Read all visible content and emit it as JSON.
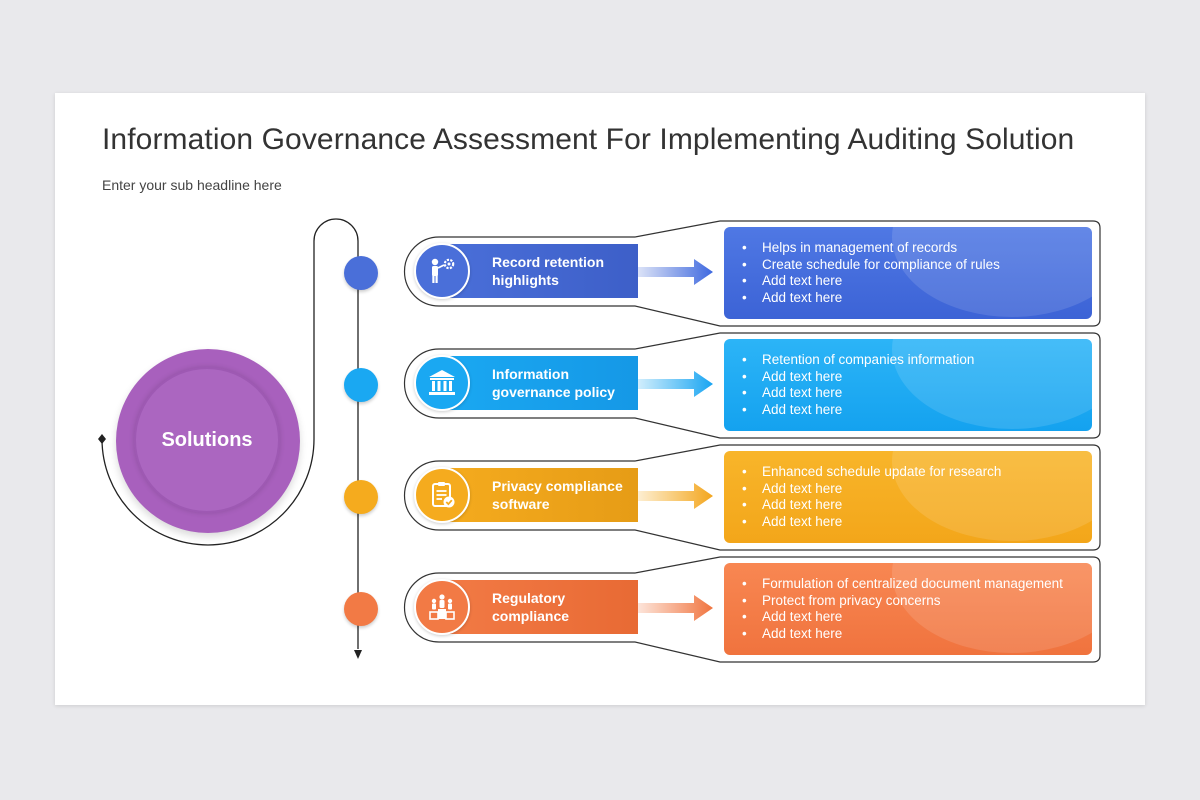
{
  "title": "Information Governance Assessment For Implementing Auditing Solution",
  "subtitle": "Enter your sub headline here",
  "hub": {
    "label": "Solutions",
    "color": "#a860bd"
  },
  "items": [
    {
      "label": "Record retention highlights",
      "icon": "presenter-gear-icon",
      "color": "#4a6fd9",
      "bullets": [
        "Helps in management of records",
        "Create schedule for compliance of rules",
        "Add text here",
        "Add text here"
      ]
    },
    {
      "label": "Information governance policy",
      "icon": "institution-building-icon",
      "color": "#1aa8f2",
      "bullets": [
        "Retention of companies information",
        "Add text here",
        "Add text here",
        "Add text here"
      ]
    },
    {
      "label": "Privacy compliance software",
      "icon": "clipboard-check-icon",
      "color": "#f5ab1e",
      "bullets": [
        "Enhanced schedule update for research",
        "Add text here",
        "Add text here",
        "Add text here"
      ]
    },
    {
      "label": "Regulatory compliance",
      "icon": "podium-people-icon",
      "color": "#f27a45",
      "bullets": [
        "Formulation of centralized document management",
        "Protect from privacy concerns",
        "Add text here",
        "Add text here"
      ]
    }
  ]
}
